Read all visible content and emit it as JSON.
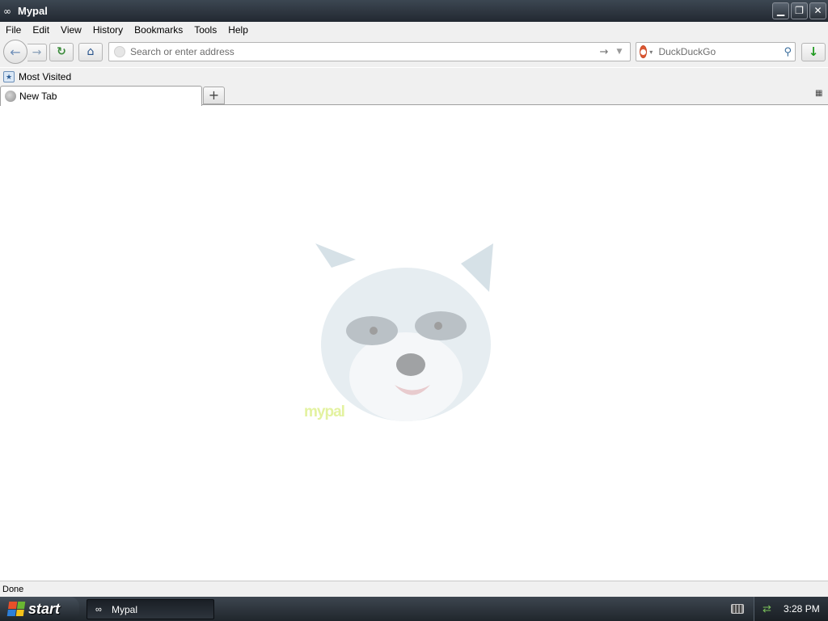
{
  "window": {
    "title": "Mypal",
    "controls": {
      "minimize": "▁",
      "restore": "❐",
      "close": "✕"
    }
  },
  "menubar": {
    "items": [
      "File",
      "Edit",
      "View",
      "History",
      "Bookmarks",
      "Tools",
      "Help"
    ]
  },
  "navbar": {
    "url_placeholder": "Search or enter address",
    "search_engine": "DuckDuckGo",
    "icons": {
      "back": "←",
      "forward": "→",
      "reload": "↻",
      "home": "⌂",
      "go": "→",
      "dropmarker": "▼",
      "search": "⚲",
      "download": "↓",
      "engine_drop": "▾"
    }
  },
  "bookmarks": {
    "items": [
      {
        "label": "Most Visited"
      }
    ]
  },
  "tabs": {
    "items": [
      {
        "label": "New Tab",
        "active": true
      }
    ],
    "new_tab_symbol": "+",
    "list_symbol": "▦"
  },
  "content": {
    "mascot_text": "mypal"
  },
  "status": {
    "text": "Done"
  },
  "taskbar": {
    "start_label": "start",
    "items": [
      {
        "label": "Mypal"
      }
    ],
    "clock": "3:28 PM"
  },
  "colors": {
    "ddg": "#de5833",
    "taskbar": "#2a3038",
    "download_green": "#1f9a1f"
  }
}
